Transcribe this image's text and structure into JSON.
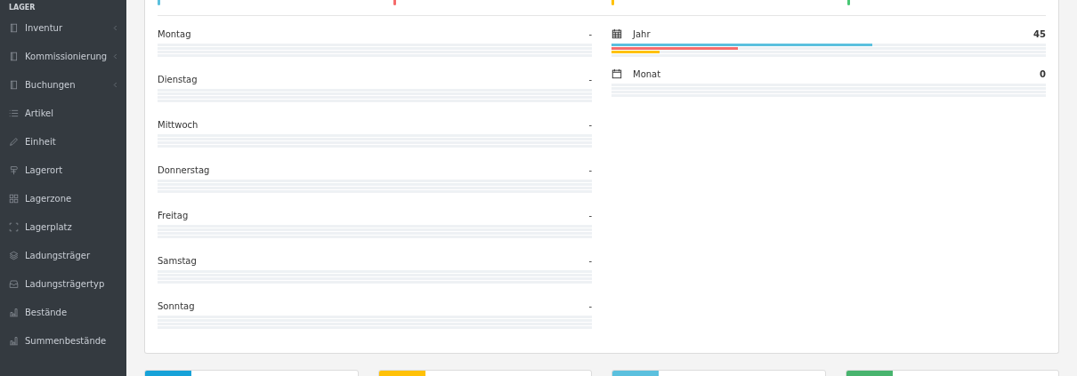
{
  "sidebar": {
    "section": "LAGER",
    "items": [
      {
        "label": "Inventur",
        "expandable": true
      },
      {
        "label": "Kommissionierung",
        "expandable": true
      },
      {
        "label": "Buchungen",
        "expandable": true
      },
      {
        "label": "Artikel",
        "expandable": false
      },
      {
        "label": "Einheit",
        "expandable": false
      },
      {
        "label": "Lagerort",
        "expandable": false
      },
      {
        "label": "Lagerzone",
        "expandable": false
      },
      {
        "label": "Lagerplatz",
        "expandable": false
      },
      {
        "label": "Ladungsträger",
        "expandable": false
      },
      {
        "label": "Ladungsträgertyp",
        "expandable": false
      },
      {
        "label": "Bestände",
        "expandable": false
      },
      {
        "label": "Summenbestände",
        "expandable": false
      }
    ]
  },
  "stats": [
    {
      "color": "#5bc0de"
    },
    {
      "color": "#f56c6c"
    },
    {
      "color": "#ffc107"
    },
    {
      "color": "#48c774"
    }
  ],
  "weekdays": [
    {
      "label": "Montag",
      "value": "-"
    },
    {
      "label": "Dienstag",
      "value": "-"
    },
    {
      "label": "Mittwoch",
      "value": "-"
    },
    {
      "label": "Donnerstag",
      "value": "-"
    },
    {
      "label": "Freitag",
      "value": "-"
    },
    {
      "label": "Samstag",
      "value": "-"
    },
    {
      "label": "Sonntag",
      "value": "-"
    }
  ],
  "periods": [
    {
      "label": "Jahr",
      "value": "45",
      "bars": [
        {
          "level": 0.6,
          "color": "#5bc0de"
        },
        {
          "level": 0.29,
          "color": "#f56c6c"
        },
        {
          "level": 0.11,
          "color": "#ffc107"
        }
      ]
    },
    {
      "label": "Monat",
      "value": "0"
    }
  ],
  "info_boxes": [
    {
      "color": "#17a2d8"
    },
    {
      "color": "#ffc107"
    },
    {
      "color": "#5bc0de"
    },
    {
      "color": "#48b46e"
    }
  ]
}
